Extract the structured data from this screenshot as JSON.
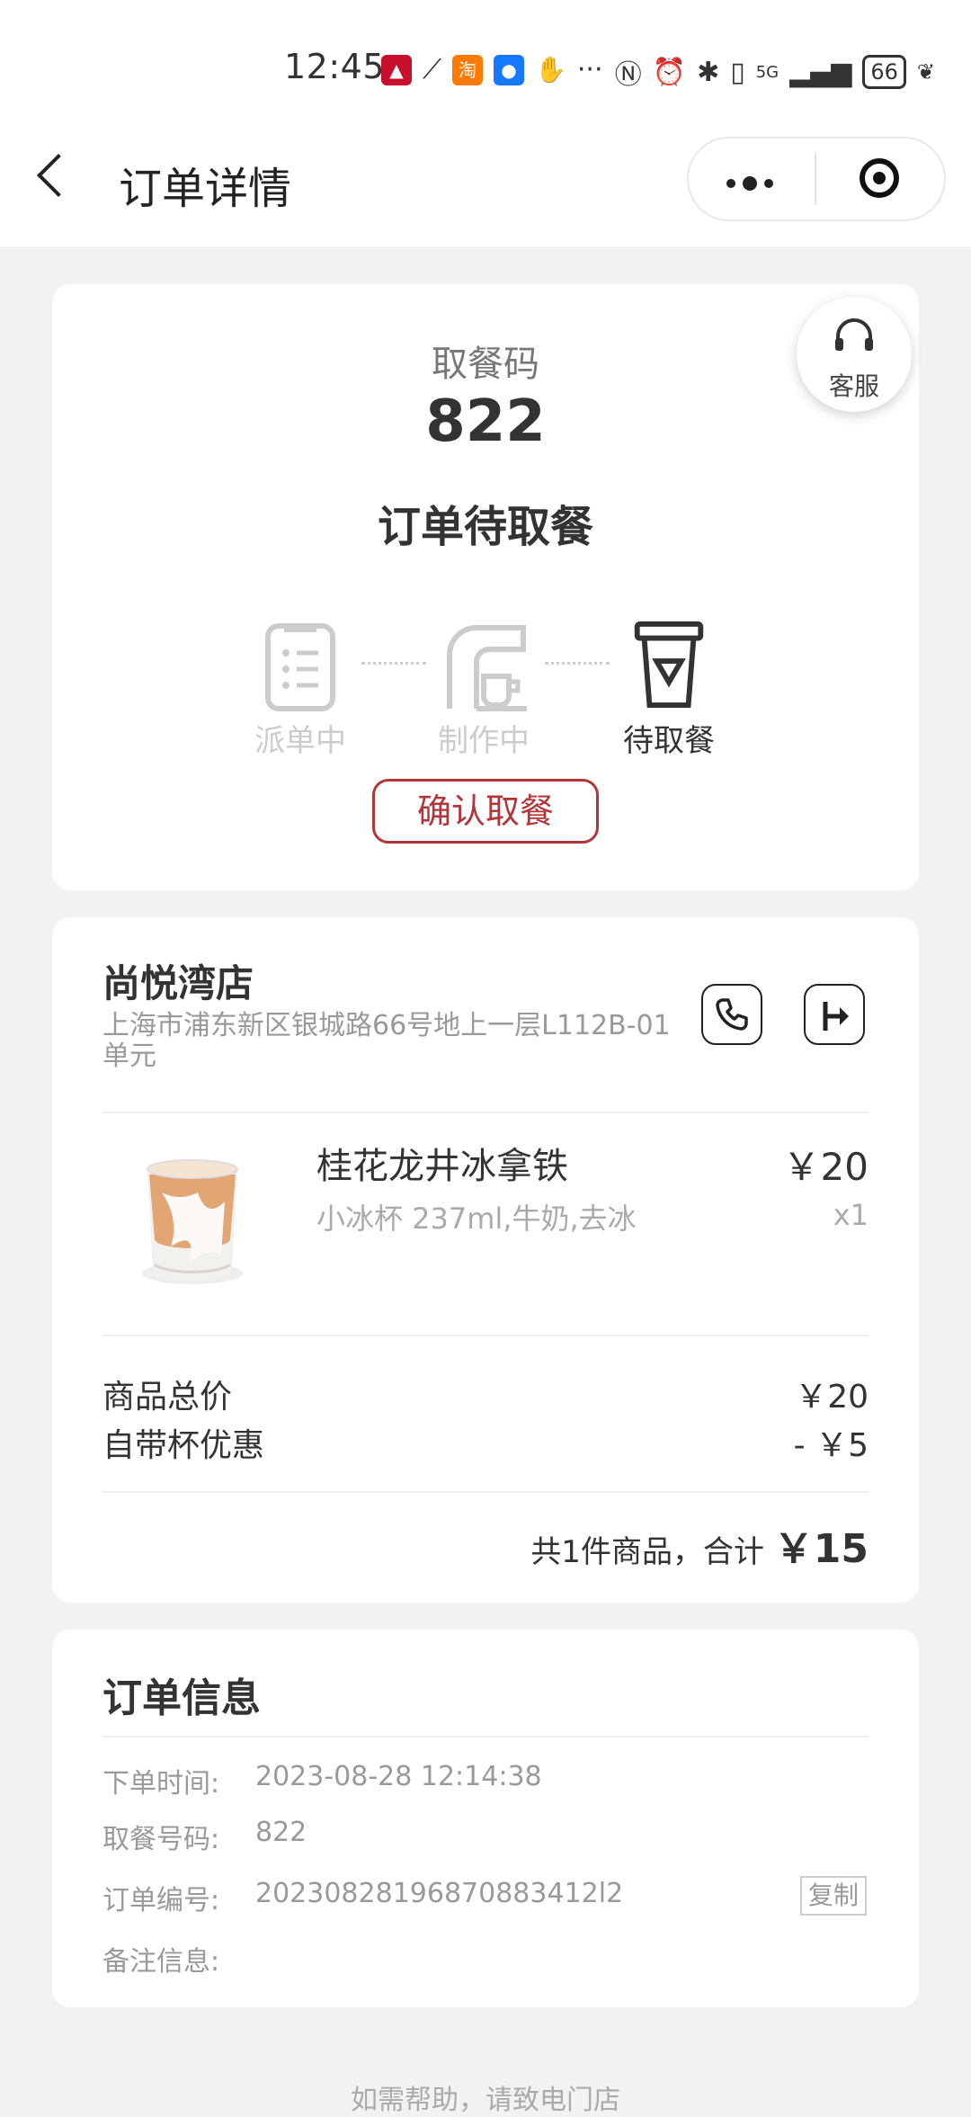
{
  "status_bar": {
    "time": "12:45",
    "more": "···",
    "battery": "66",
    "network": "5G"
  },
  "nav": {
    "title": "订单详情"
  },
  "pickup": {
    "label": "取餐码",
    "code": "822",
    "status": "订单待取餐",
    "service_label": "客服",
    "steps": [
      {
        "label": "派单中",
        "icon": "order-list-icon",
        "active": false
      },
      {
        "label": "制作中",
        "icon": "coffee-machine-icon",
        "active": false
      },
      {
        "label": "待取餐",
        "icon": "takeaway-cup-icon",
        "active": true
      }
    ],
    "confirm_label": "确认取餐"
  },
  "store": {
    "name": "尚悦湾店",
    "address": "上海市浦东新区银城路66号地上一层L112B-01单元"
  },
  "product": {
    "name": "桂花龙井冰拿铁",
    "spec": "小冰杯 237ml,牛奶,去冰",
    "price": "￥20",
    "qty": "x1"
  },
  "summary": {
    "subtotal_label": "商品总价",
    "subtotal_value": "￥20",
    "discount_label": "自带杯优惠",
    "discount_value": "- ￥5",
    "total_prefix": "共1件商品，合计",
    "total_value": "￥15"
  },
  "order_info": {
    "title": "订单信息",
    "rows": [
      {
        "label": "下单时间:",
        "value": "2023-08-28 12:14:38"
      },
      {
        "label": "取餐号码:",
        "value": "822"
      },
      {
        "label": "订单编号:",
        "value": "20230828196870883412l2"
      },
      {
        "label": "备注信息:",
        "value": ""
      }
    ],
    "copy_label": "复制"
  },
  "footer": {
    "help_text": "如需帮助，请致电门店"
  },
  "colors": {
    "accent": "#b2353a",
    "background": "#f2f2f2",
    "card": "#ffffff"
  }
}
